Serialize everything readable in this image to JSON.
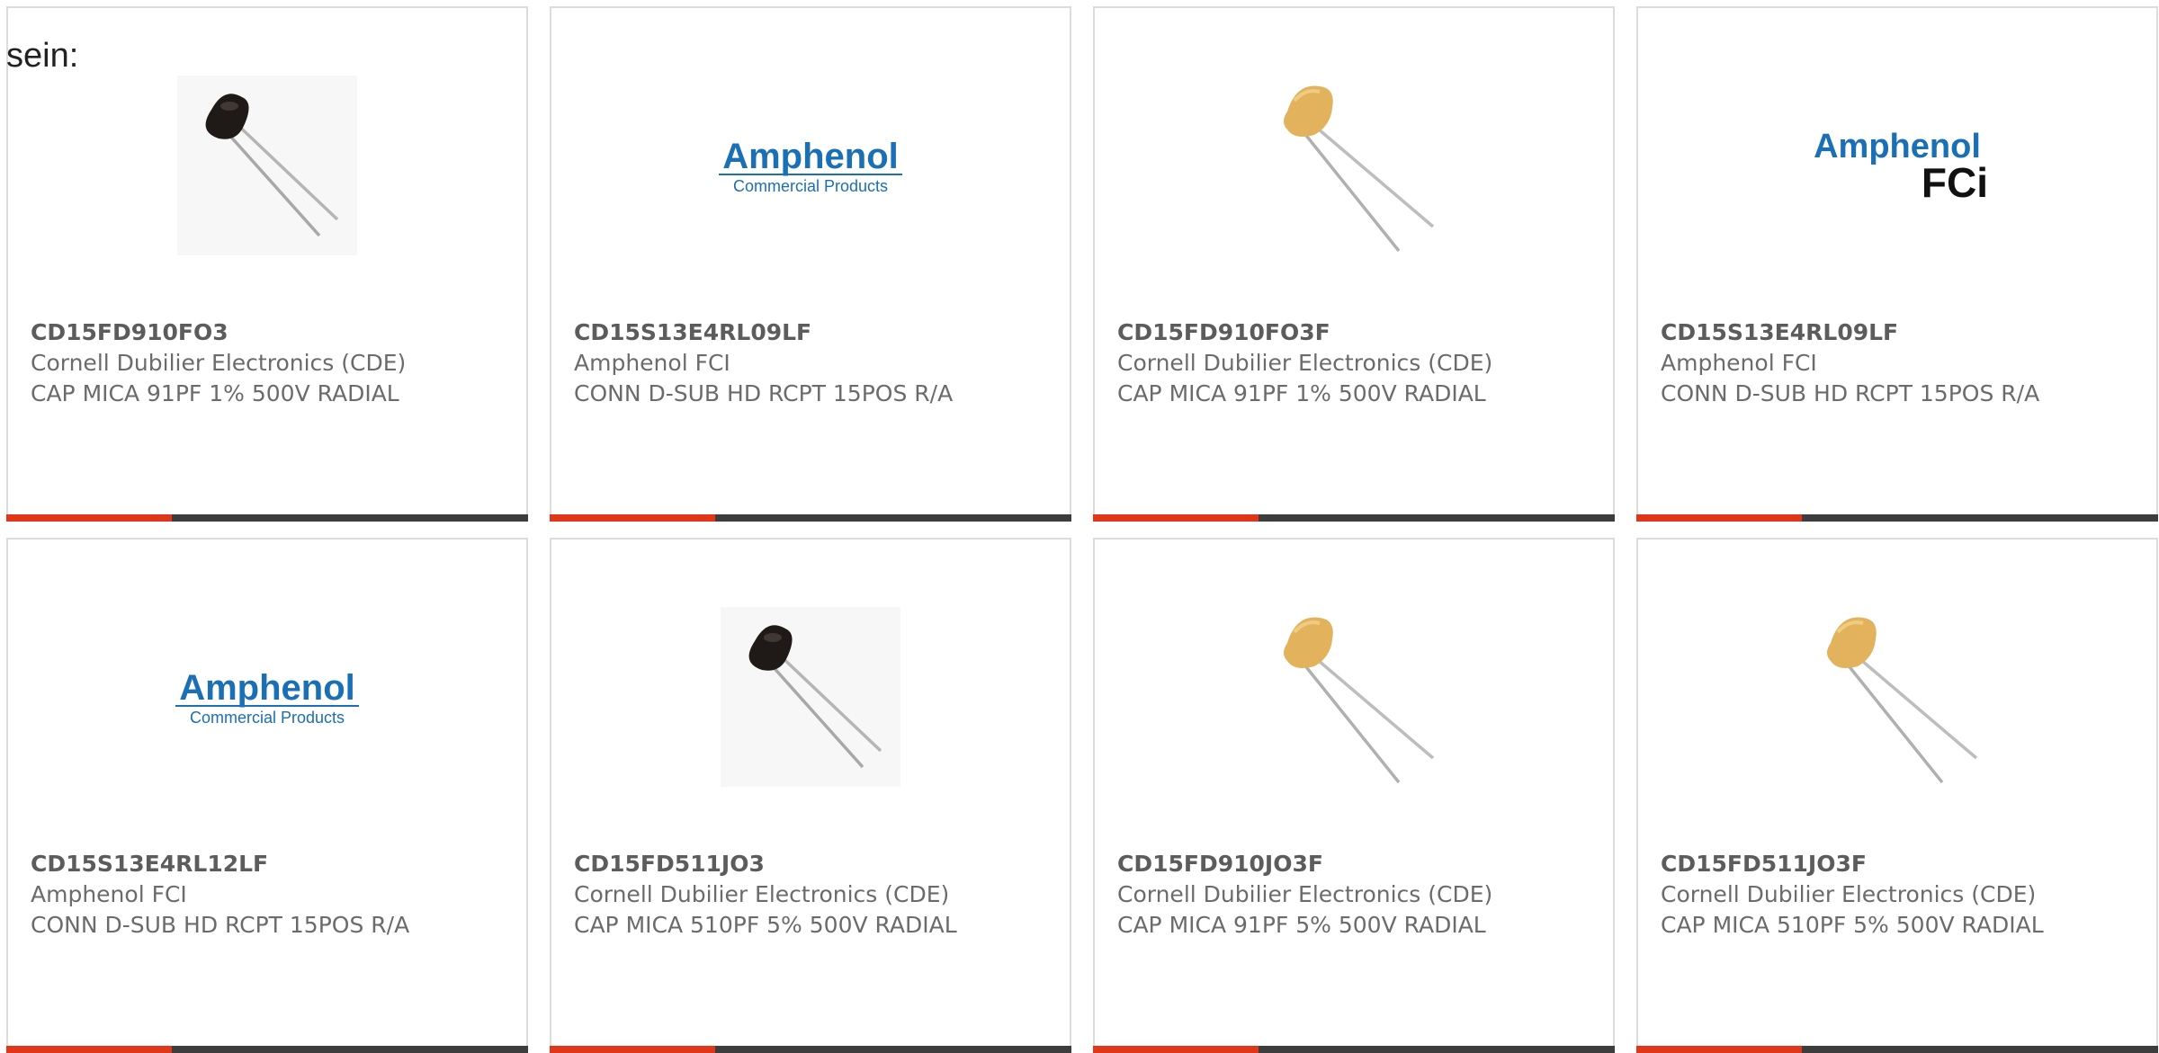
{
  "intro_text": "sein:",
  "colors": {
    "accent": "#e0371a",
    "bar": "#3d3d3d",
    "text": "#6b6b6b",
    "amphenol_blue": "#1a6fb5"
  },
  "products": [
    {
      "part_number": "CD15FD910FO3",
      "manufacturer": "Cornell Dubilier Electronics (CDE)",
      "description": "CAP MICA 91PF 1% 500V RADIAL",
      "image": "black-mica-capacitor"
    },
    {
      "part_number": "CD15S13E4RL09LF",
      "manufacturer": "Amphenol FCI",
      "description": "CONN D-SUB HD RCPT 15POS R/A",
      "image": "amphenol-commercial-products-logo",
      "logo_title": "Amphenol",
      "logo_subtitle": "Commercial Products"
    },
    {
      "part_number": "CD15FD910FO3F",
      "manufacturer": "Cornell Dubilier Electronics (CDE)",
      "description": "CAP MICA 91PF 1% 500V RADIAL",
      "image": "yellow-mica-capacitor"
    },
    {
      "part_number": "CD15S13E4RL09LF",
      "manufacturer": "Amphenol FCI",
      "description": "CONN D-SUB HD RCPT 15POS R/A",
      "image": "amphenol-fci-logo",
      "logo_title": "Amphenol",
      "logo_subtitle": "FCi"
    },
    {
      "part_number": "CD15S13E4RL12LF",
      "manufacturer": "Amphenol FCI",
      "description": "CONN D-SUB HD RCPT 15POS R/A",
      "image": "amphenol-commercial-products-logo",
      "logo_title": "Amphenol",
      "logo_subtitle": "Commercial Products"
    },
    {
      "part_number": "CD15FD511JO3",
      "manufacturer": "Cornell Dubilier Electronics (CDE)",
      "description": "CAP MICA 510PF 5% 500V RADIAL",
      "image": "black-mica-capacitor"
    },
    {
      "part_number": "CD15FD910JO3F",
      "manufacturer": "Cornell Dubilier Electronics (CDE)",
      "description": "CAP MICA 91PF 5% 500V RADIAL",
      "image": "yellow-mica-capacitor"
    },
    {
      "part_number": "CD15FD511JO3F",
      "manufacturer": "Cornell Dubilier Electronics (CDE)",
      "description": "CAP MICA 510PF 5% 500V RADIAL",
      "image": "yellow-mica-capacitor"
    }
  ]
}
